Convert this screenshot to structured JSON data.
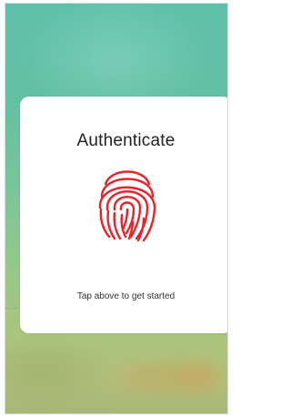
{
  "dialog": {
    "title": "Authenticate",
    "hint": "Tap above to get started"
  },
  "icons": {
    "fingerprint": "fingerprint-icon"
  },
  "colors": {
    "fingerprint": "#e8232a",
    "background_top": "#5fc1aa",
    "background_bottom": "#a8b679",
    "card": "#ffffff"
  }
}
